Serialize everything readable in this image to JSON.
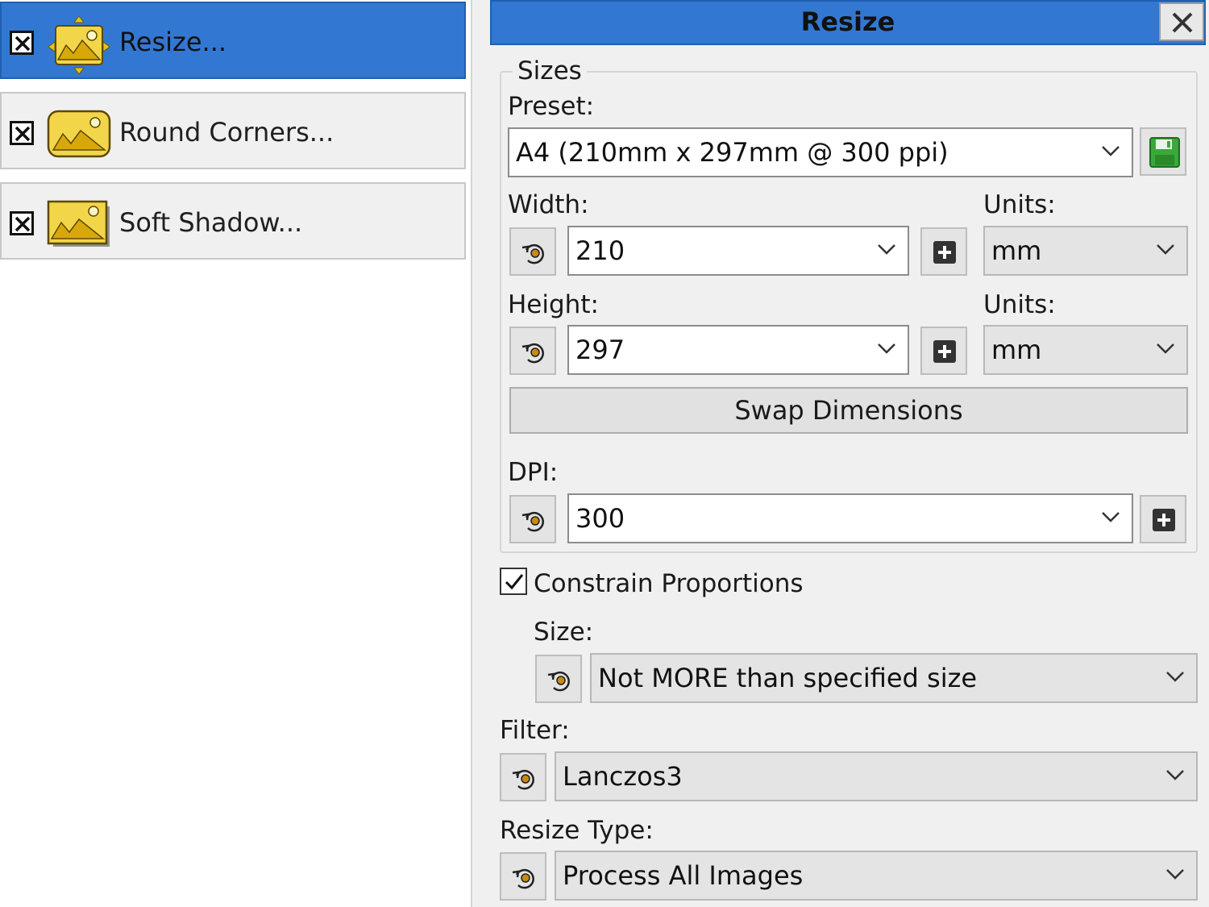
{
  "actions": [
    {
      "label": "Resize...",
      "checked": true,
      "selected": true,
      "icon": "resize-image-icon"
    },
    {
      "label": "Round Corners...",
      "checked": true,
      "selected": false,
      "icon": "round-corners-image-icon"
    },
    {
      "label": "Soft Shadow...",
      "checked": true,
      "selected": false,
      "icon": "soft-shadow-image-icon"
    }
  ],
  "panel": {
    "title": "Resize",
    "close_icon": "close-icon"
  },
  "sizes": {
    "group_title": "Sizes",
    "preset_label": "Preset:",
    "preset_value": "A4 (210mm x 297mm @ 300 ppi)",
    "width_label": "Width:",
    "width_value": "210",
    "width_units_label": "Units:",
    "width_units_value": "mm",
    "height_label": "Height:",
    "height_value": "297",
    "height_units_label": "Units:",
    "height_units_value": "mm",
    "swap_label": "Swap Dimensions",
    "dpi_label": "DPI:",
    "dpi_value": "300"
  },
  "constrain": {
    "label": "Constrain Proportions",
    "checked": true,
    "size_label": "Size:",
    "size_value": "Not MORE than specified size"
  },
  "filter": {
    "label": "Filter:",
    "value": "Lanczos3"
  },
  "resize_type": {
    "label": "Resize Type:",
    "value": "Process All Images"
  },
  "colors": {
    "selection": "#3278d2",
    "panel_bg": "#f0f0f0",
    "save_icon": "#3aa83a",
    "image_icon_fill": "#e8c21a"
  }
}
